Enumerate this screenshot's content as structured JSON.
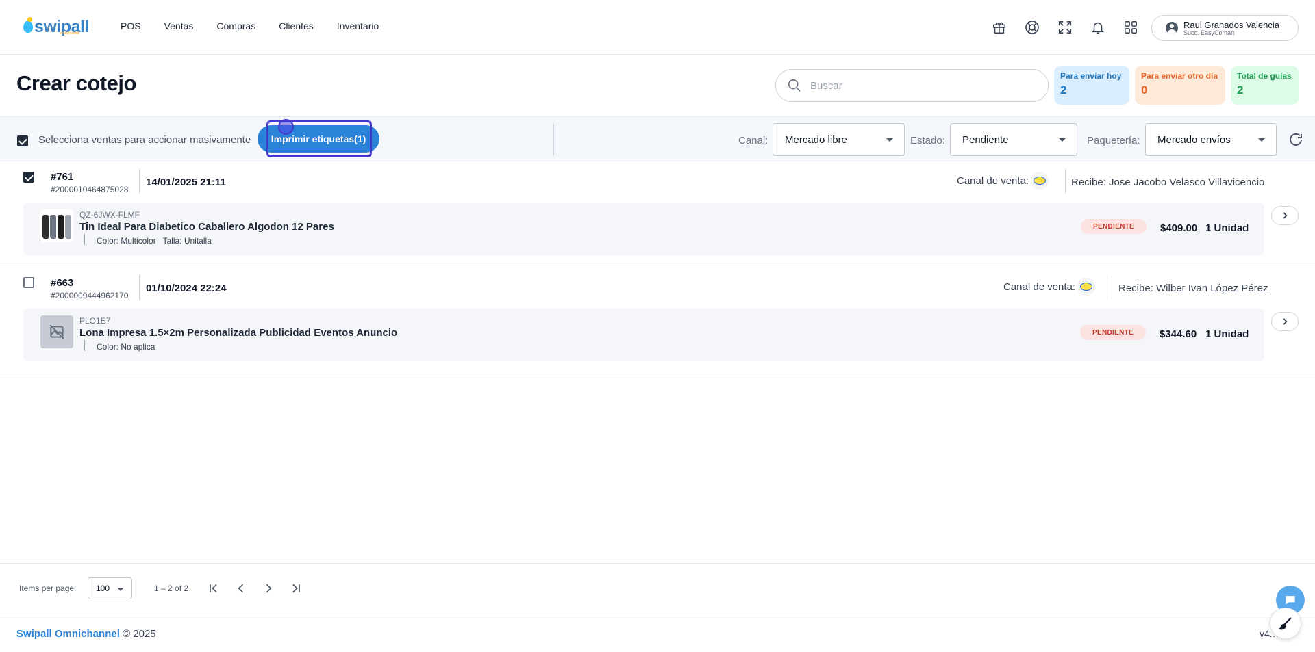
{
  "app": {
    "logo_text": "swipall",
    "logo_sub": "omnichannel"
  },
  "nav": {
    "items": [
      "POS",
      "Ventas",
      "Compras",
      "Clientes",
      "Inventario"
    ],
    "icons": [
      "gift-icon",
      "lifebuoy-icon",
      "fullscreen-icon",
      "bell-icon",
      "apps-grid-icon"
    ]
  },
  "user": {
    "name": "Raul Granados Valencia",
    "branch": "Succ. EasyComart"
  },
  "header": {
    "title": "Crear cotejo",
    "search_placeholder": "Buscar"
  },
  "stats": [
    {
      "label": "Para enviar hoy",
      "value": "2",
      "color": "#1d78c1"
    },
    {
      "label": "Para enviar otro día",
      "value": "0",
      "color": "#e8652a"
    },
    {
      "label": "Total de guías",
      "value": "2",
      "color": "#1f9d55"
    }
  ],
  "toolbar": {
    "mass_label": "Selecciona ventas para accionar masivamente",
    "print_label": "Imprimir etiquetas(1)",
    "canal_label": "Canal:",
    "canal_value": "Mercado libre",
    "estado_label": "Estado:",
    "estado_value": "Pendiente",
    "paqueteria_label": "Paquetería:",
    "paqueteria_value": "Mercado envíos"
  },
  "orders": [
    {
      "checked": true,
      "number": "#761",
      "external": "#2000010464875028",
      "date": "14/01/2025 21:11",
      "canal_label": "Canal de venta:",
      "recibe": "Recibe: Jose Jacobo Velasco Villavicencio",
      "item": {
        "sku": "QZ-6JWX-FLMF",
        "name": "Tin Ideal Para Diabetico Caballero Algodon 12 Pares",
        "attrs": "Color: Multicolor   Talla: Unitalla",
        "status": "PENDIENTE",
        "price": "$409.00",
        "units": "1 Unidad"
      }
    },
    {
      "checked": false,
      "number": "#663",
      "external": "#2000009444962170",
      "date": "01/10/2024 22:24",
      "canal_label": "Canal de venta:",
      "recibe": "Recibe: Wilber Ivan López Pérez",
      "item": {
        "sku": "PLO1E7",
        "name": "Lona Impresa 1.5×2m Personalizada Publicidad Eventos Anuncio",
        "attrs": "Color: No aplica",
        "status": "PENDIENTE",
        "price": "$344.60",
        "units": "1 Unidad"
      }
    }
  ],
  "pager": {
    "ipp_label": "Items per page:",
    "ipp_value": "100",
    "range": "1 – 2 of 2"
  },
  "footer": {
    "brand": "Swipall Omnichannel",
    "copyright": " © 2025",
    "version": "v4.… 5"
  }
}
